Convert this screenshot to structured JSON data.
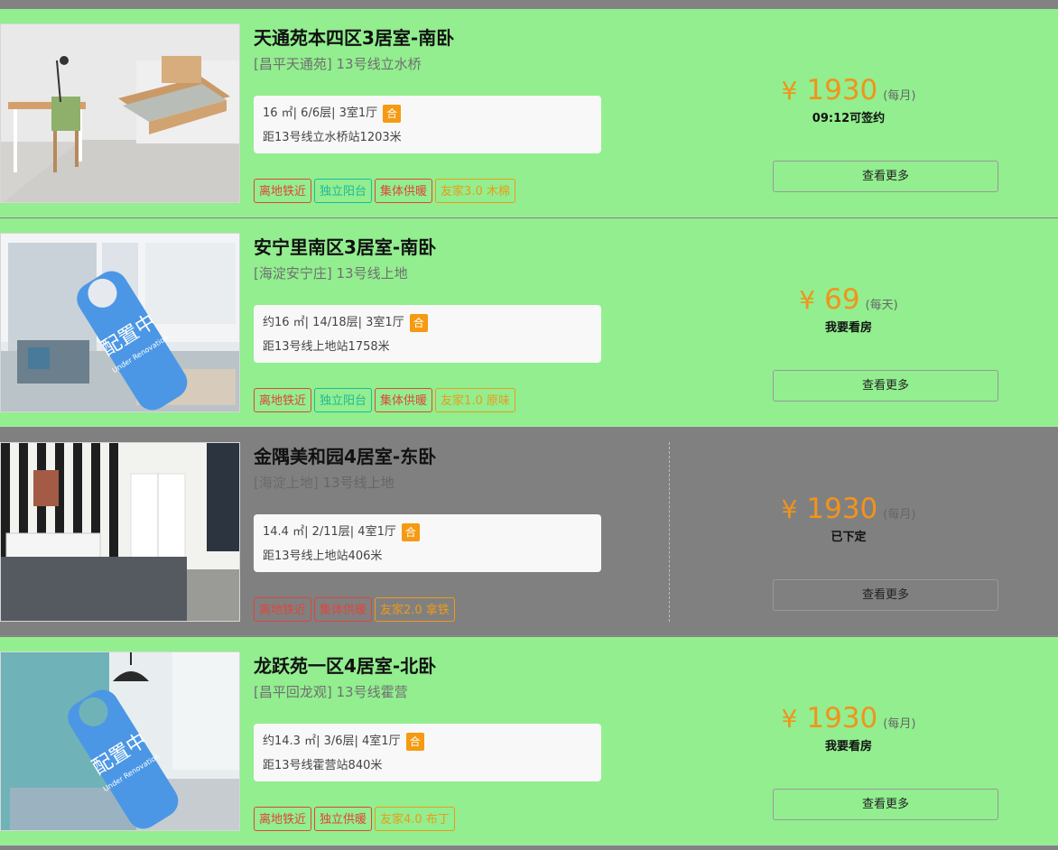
{
  "listings": [
    {
      "title": "天通苑本四区3居室-南卧",
      "region": "[昌平天通苑]",
      "line": "13号线立水桥",
      "details": "16 ㎡| 6/6层| 3室1厅",
      "he_badge": "合",
      "distance": "距13号线立水桥站1203米",
      "tags": [
        {
          "label": "离地铁近",
          "color": "#e0453b"
        },
        {
          "label": "独立阳台",
          "color": "#1fb99a"
        },
        {
          "label": "集体供暖",
          "color": "#e0453b"
        },
        {
          "label": "友家3.0 木棉",
          "color": "#ee9a18"
        }
      ],
      "currency": "¥",
      "price": "1930",
      "unit": "(每月)",
      "status": "09:12可签约",
      "more_label": "查看更多",
      "photo_overlay": "",
      "photo_overlay_en": ""
    },
    {
      "title": "安宁里南区3居室-南卧",
      "region": "[海淀安宁庄]",
      "line": "13号线上地",
      "details": "约16 ㎡| 14/18层| 3室1厅",
      "he_badge": "合",
      "distance": "距13号线上地站1758米",
      "tags": [
        {
          "label": "离地铁近",
          "color": "#e0453b"
        },
        {
          "label": "独立阳台",
          "color": "#1fb99a"
        },
        {
          "label": "集体供暖",
          "color": "#e0453b"
        },
        {
          "label": "友家1.0 原味",
          "color": "#ee9a18"
        }
      ],
      "currency": "¥",
      "price": "69",
      "unit": "(每天)",
      "status": "我要看房",
      "more_label": "查看更多",
      "photo_overlay": "配置中",
      "photo_overlay_en": "Under Renovation"
    },
    {
      "title": "金隅美和园4居室-东卧",
      "region": "[海淀上地]",
      "line": "13号线上地",
      "details": "14.4 ㎡| 2/11层| 4室1厅",
      "he_badge": "合",
      "distance": "距13号线上地站406米",
      "tags": [
        {
          "label": "离地铁近",
          "color": "#e0453b"
        },
        {
          "label": "集体供暖",
          "color": "#e0453b"
        },
        {
          "label": "友家2.0 拿铁",
          "color": "#ee9a18"
        }
      ],
      "currency": "¥",
      "price": "1930",
      "unit": "(每月)",
      "status": "已下定",
      "more_label": "查看更多",
      "photo_overlay": "",
      "photo_overlay_en": ""
    },
    {
      "title": "龙跃苑一区4居室-北卧",
      "region": "[昌平回龙观]",
      "line": "13号线霍营",
      "details": "约14.3 ㎡| 3/6层| 4室1厅",
      "he_badge": "合",
      "distance": "距13号线霍营站840米",
      "tags": [
        {
          "label": "离地铁近",
          "color": "#e0453b"
        },
        {
          "label": "独立供暖",
          "color": "#e0453b"
        },
        {
          "label": "友家4.0 布丁",
          "color": "#ee9a18"
        }
      ],
      "currency": "¥",
      "price": "1930",
      "unit": "(每月)",
      "status": "我要看房",
      "more_label": "查看更多",
      "photo_overlay": "配置中",
      "photo_overlay_en": "Under Renovation"
    }
  ]
}
